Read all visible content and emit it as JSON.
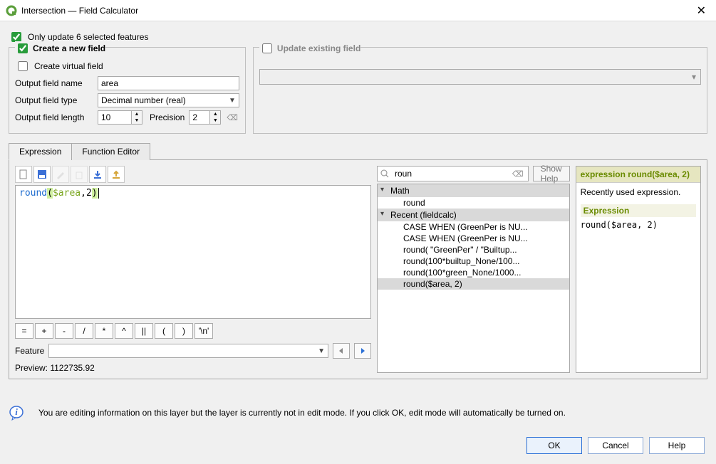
{
  "window": {
    "title": "Intersection — Field Calculator"
  },
  "top": {
    "only_update_label": "Only update 6 selected features"
  },
  "create": {
    "legend": "Create a new field",
    "virtual_label": "Create virtual field",
    "name_label": "Output field name",
    "name_value": "area",
    "type_label": "Output field type",
    "type_value": "Decimal number (real)",
    "length_label": "Output field length",
    "length_value": "10",
    "precision_label": "Precision",
    "precision_value": "2"
  },
  "update": {
    "legend": "Update existing field"
  },
  "tabs": {
    "expression": "Expression",
    "function_editor": "Function Editor"
  },
  "expr": {
    "code_round": "round",
    "code_open": "(",
    "code_var": "$area",
    "code_comma": ",",
    "code_num": "2",
    "code_close": ")",
    "ops": [
      "=",
      "+",
      "-",
      "/",
      "*",
      "^",
      "||",
      "(",
      ")",
      "'\\n'"
    ],
    "feature_label": "Feature",
    "preview_label": "Preview:  1122735.92"
  },
  "search": {
    "placeholder": "",
    "value": "roun",
    "show_help": "Show Help"
  },
  "tree": {
    "g1": "Math",
    "i1": "round",
    "g2": "Recent (fieldcalc)",
    "r1": "CASE WHEN (GreenPer is NU...",
    "r2": "CASE WHEN (GreenPer is NU...",
    "r3": "round( \"GreenPer\" / \"Builtup...",
    "r4": "round(100*builtup_None/100...",
    "r5": "round(100*green_None/1000...",
    "r6": "round($area, 2)"
  },
  "help": {
    "title": "expression round($area, 2)",
    "recent": "Recently used expression.",
    "sub": "Expression",
    "code": "round($area, 2)"
  },
  "info": {
    "text": "You are editing information on this layer but the layer is currently not in edit mode. If you click OK, edit mode will automatically be turned on."
  },
  "buttons": {
    "ok": "OK",
    "cancel": "Cancel",
    "help": "Help"
  }
}
